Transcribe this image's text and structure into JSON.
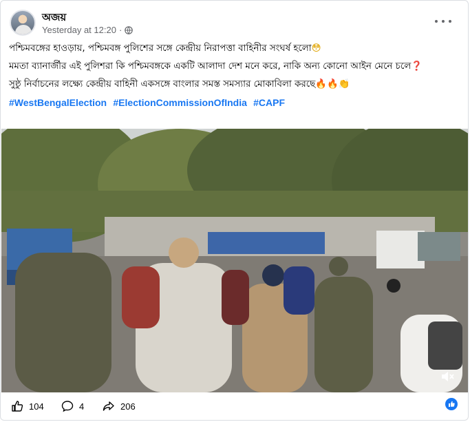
{
  "post": {
    "author": "অজয়",
    "timestamp": "Yesterday at 12:20",
    "separator": "·",
    "lines": [
      "পশ্চিমবঙ্গের হাওড়ায়, পশ্চিমবঙ্গ পুলিশের সঙ্গে কেন্দ্রীয় নিরাপত্তা বাহিনীর সংঘর্ষ হলো",
      "মমতা ব্যানার্জীর এই পুলিশরা কি পশ্চিমবঙ্গকে একটি আলাদা দেশ মনে করে, নাকি অন্য কোনো আইন মেনে চলে",
      "সুষ্ঠু নির্বাচনের লক্ষ্যে কেন্দ্রীয় বাহিনী একসঙ্গে বাংলার সমস্ত সমস্যার মোকাবিলা করছে"
    ],
    "emojis": {
      "line1": "😳",
      "line2": "❓",
      "line3_fire1": "🔥",
      "line3_fire2": "🔥",
      "line3_clap": "👏"
    },
    "hashtags": [
      "#WestBengalElection",
      "#ElectionCommissionOfIndia",
      "#CAPF"
    ]
  },
  "footer": {
    "likes": "104",
    "comments": "4",
    "shares": "206"
  },
  "colors": {
    "link": "#1877f2",
    "muted": "#65676b",
    "text": "#050505"
  }
}
